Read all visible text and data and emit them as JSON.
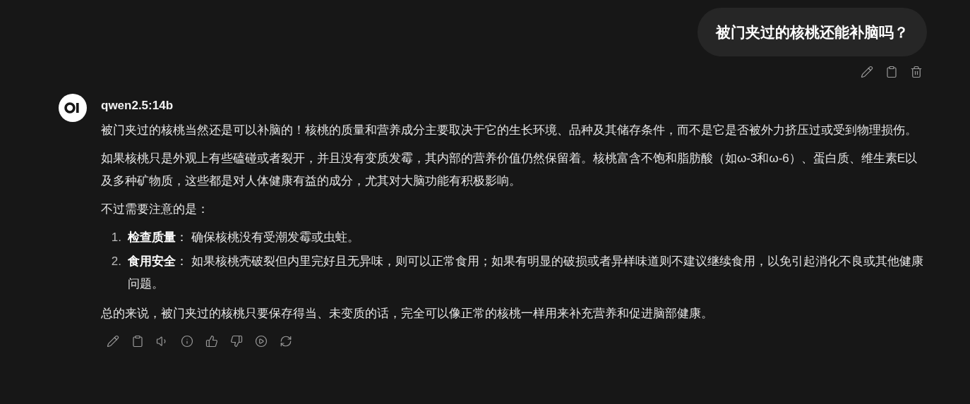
{
  "user_message": {
    "text": "被门夹过的核桃还能补脑吗？"
  },
  "assistant_message": {
    "model": "qwen2.5:14b",
    "paragraphs": [
      "被门夹过的核桃当然还是可以补脑的！核桃的质量和营养成分主要取决于它的生长环境、品种及其储存条件，而不是它是否被外力挤压过或受到物理损伤。",
      "如果核桃只是外观上有些磕碰或者裂开，并且没有变质发霉，其内部的营养价值仍然保留着。核桃富含不饱和脂肪酸（如ω-3和ω-6）、蛋白质、维生素E以及多种矿物质，这些都是对人体健康有益的成分，尤其对大脑功能有积极影响。",
      "不过需要注意的是："
    ],
    "list": [
      {
        "number": "1.",
        "text": "**检查质量**： 确保核桃没有受潮发霉或虫蛀。"
      },
      {
        "number": "2.",
        "text": "**食用安全**： 如果核桃壳破裂但内里完好且无异味，则可以正常食用；如果有明显的破损或者异样味道则不建议继续食用，以免引起消化不良或其他健康问题。"
      }
    ],
    "conclusion": "总的来说，被门夹过的核桃只要保存得当、未变质的话，完全可以像正常的核桃一样用来补充营养和促进脑部健康。"
  }
}
